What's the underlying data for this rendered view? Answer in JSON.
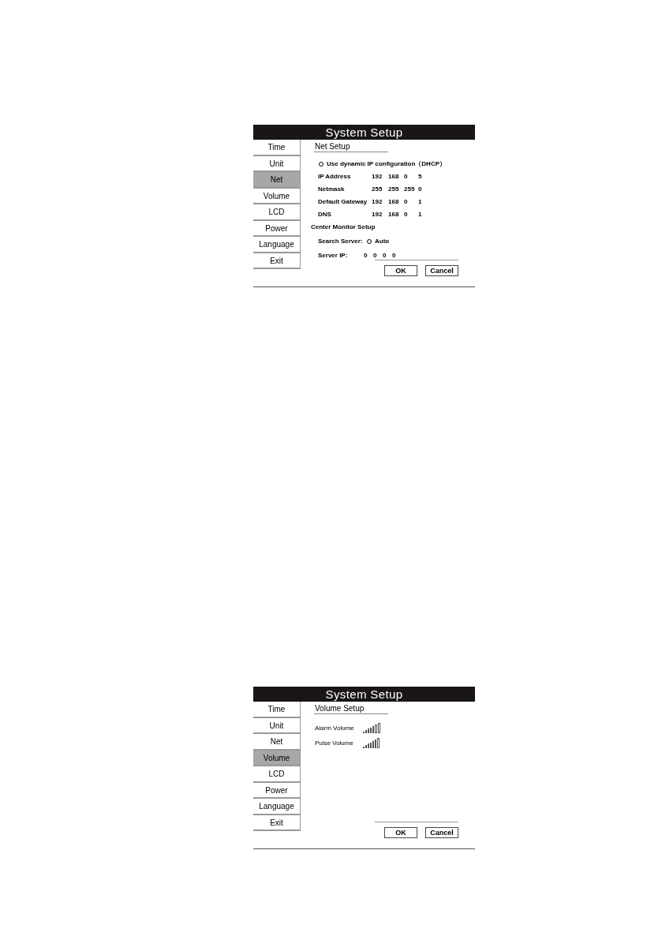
{
  "screens": [
    {
      "title": "System Setup",
      "menu": [
        {
          "label": "Time",
          "selected": false
        },
        {
          "label": "Unit",
          "selected": false
        },
        {
          "label": "Net",
          "selected": true
        },
        {
          "label": "Volume",
          "selected": false
        },
        {
          "label": "LCD",
          "selected": false
        },
        {
          "label": "Power",
          "selected": false
        },
        {
          "label": "Language",
          "selected": false
        },
        {
          "label": "Exit",
          "selected": false
        }
      ],
      "panel": {
        "kind": "net",
        "heading": "Net Setup",
        "dhcp": {
          "label": "Use dynamic IP configuration（DHCP）",
          "checked": false
        },
        "fields": [
          {
            "label": "IP Address",
            "octets": [
              "192",
              "168",
              "0",
              "5"
            ]
          },
          {
            "label": "Netmask",
            "octets": [
              "255",
              "255",
              "255",
              "0"
            ]
          },
          {
            "label": "Default Gateway",
            "octets": [
              "192",
              "168",
              "0",
              "1"
            ]
          },
          {
            "label": "DNS",
            "octets": [
              "192",
              "168",
              "0",
              "1"
            ]
          }
        ],
        "center_heading": "Center Monitor Setup",
        "search_server": {
          "label": "Search Server:",
          "option": "Auto",
          "checked": false
        },
        "server_ip": {
          "label": "Server IP:",
          "octets": [
            "0",
            "0",
            "0",
            "0"
          ]
        }
      },
      "buttons": [
        "OK",
        "Cancel"
      ]
    },
    {
      "title": "System Setup",
      "menu": [
        {
          "label": "Time",
          "selected": false
        },
        {
          "label": "Unit",
          "selected": false
        },
        {
          "label": "Net",
          "selected": false
        },
        {
          "label": "Volume",
          "selected": true
        },
        {
          "label": "LCD",
          "selected": false
        },
        {
          "label": "Power",
          "selected": false
        },
        {
          "label": "Language",
          "selected": false
        },
        {
          "label": "Exit",
          "selected": false
        }
      ],
      "panel": {
        "kind": "volume",
        "heading": "Volume Setup",
        "volumes": [
          {
            "label": "Alarm Volume",
            "level": 0.71
          },
          {
            "label": "Pulse Volume",
            "level": 0.86
          }
        ]
      },
      "buttons": [
        "OK",
        "Cancel"
      ]
    }
  ]
}
